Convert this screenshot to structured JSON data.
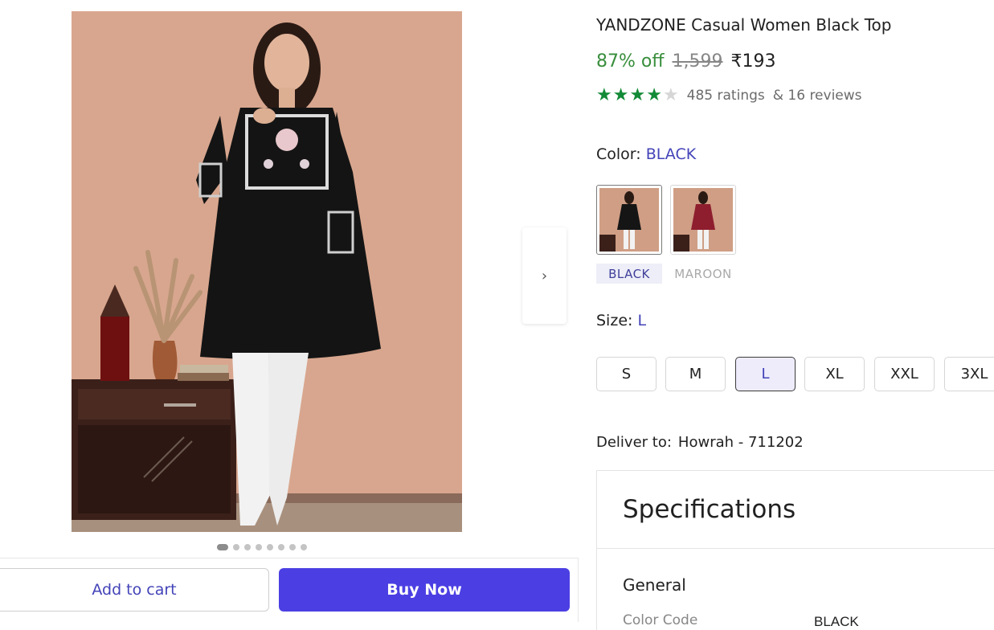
{
  "product": {
    "title": "YANDZONE Casual Women Black Top",
    "discount": "87% off",
    "mrp": "1,599",
    "price": "₹193",
    "rating_stars": 4,
    "ratings_text": "485 ratings",
    "reviews_text": "& 16 reviews"
  },
  "gallery": {
    "next_icon": "›",
    "dot_count": 8,
    "active_dot": 0
  },
  "actions": {
    "add_to_cart": "Add to cart",
    "buy_now": "Buy Now"
  },
  "color": {
    "label": "Color:",
    "selected": "BLACK",
    "options": [
      "BLACK",
      "MAROON"
    ]
  },
  "size": {
    "label": "Size:",
    "selected": "L",
    "options": [
      "S",
      "M",
      "L",
      "XL",
      "XXL",
      "3XL"
    ]
  },
  "delivery": {
    "label": "Deliver to:",
    "location": "Howrah - 711202"
  },
  "specifications": {
    "title": "Specifications",
    "section": "General",
    "rows": [
      {
        "key": "Color Code",
        "value": "BLACK"
      }
    ]
  },
  "colors": {
    "accent": "#4343b9",
    "buy_button": "#4b3fe3",
    "discount_green": "#388e3c",
    "star_green": "#138a37"
  }
}
